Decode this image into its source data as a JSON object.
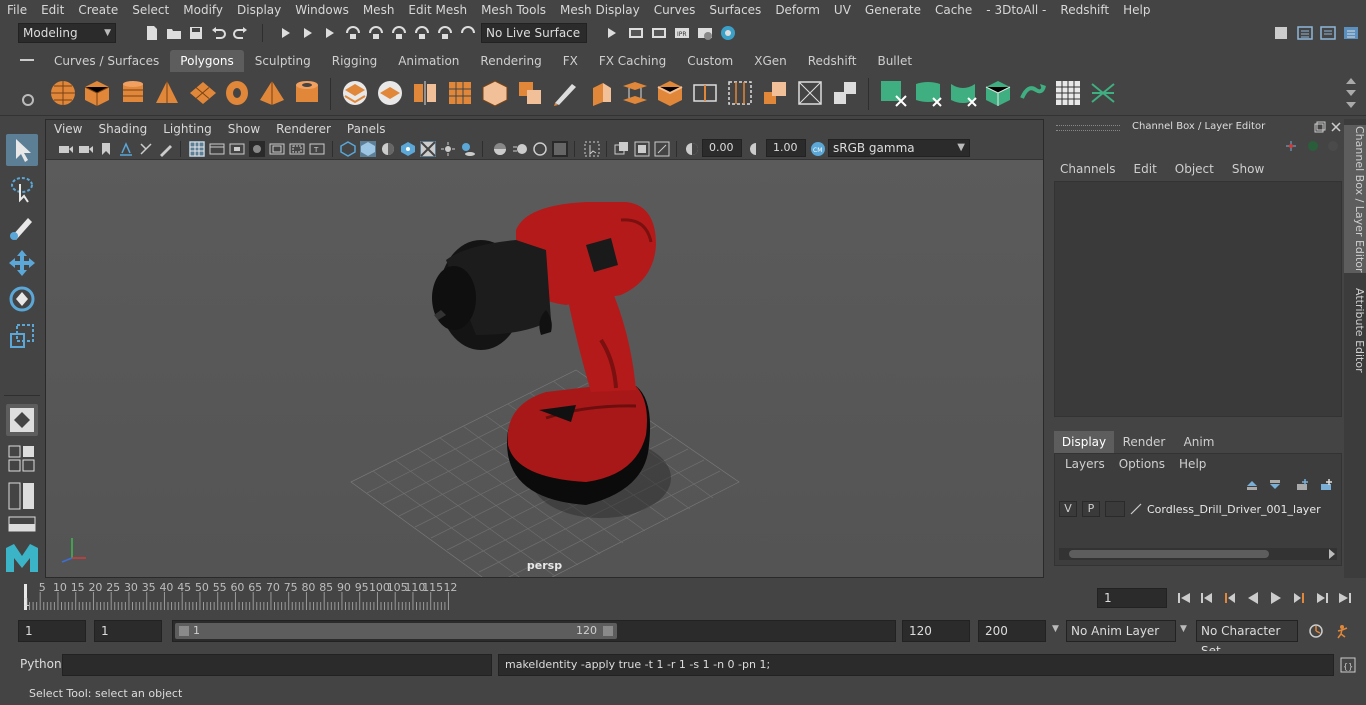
{
  "menubar": [
    "File",
    "Edit",
    "Create",
    "Select",
    "Modify",
    "Display",
    "Windows",
    "Mesh",
    "Edit Mesh",
    "Mesh Tools",
    "Mesh Display",
    "Curves",
    "Surfaces",
    "Deform",
    "UV",
    "Generate",
    "Cache",
    "- 3DtoAll -",
    "Redshift",
    "Help"
  ],
  "status": {
    "mode": "Modeling",
    "live_surface": "No Live Surface"
  },
  "shelf_tabs": [
    "Curves / Surfaces",
    "Polygons",
    "Sculpting",
    "Rigging",
    "Animation",
    "Rendering",
    "FX",
    "FX Caching",
    "Custom",
    "XGen",
    "Redshift",
    "Bullet"
  ],
  "shelf_active": "Polygons",
  "viewport": {
    "menu": [
      "View",
      "Shading",
      "Lighting",
      "Show",
      "Renderer",
      "Panels"
    ],
    "exposure": "0.00",
    "gamma": "1.00",
    "colorspace": "sRGB gamma",
    "camera": "persp"
  },
  "channel_box": {
    "title": "Channel Box / Layer Editor",
    "menu": [
      "Channels",
      "Edit",
      "Object",
      "Show"
    ]
  },
  "layer_editor": {
    "tabs": [
      "Display",
      "Render",
      "Anim"
    ],
    "active_tab": "Display",
    "menu": [
      "Layers",
      "Options",
      "Help"
    ],
    "layers": [
      {
        "v": "V",
        "p": "P",
        "name": "Cordless_Drill_Driver_001_layer"
      }
    ]
  },
  "side_tabs": [
    "Channel Box / Layer Editor",
    "Attribute Editor"
  ],
  "timeline": {
    "ticks": [
      "5",
      "10",
      "15",
      "20",
      "25",
      "30",
      "35",
      "40",
      "45",
      "50",
      "55",
      "60",
      "65",
      "70",
      "75",
      "80",
      "85",
      "90",
      "95",
      "100",
      "105",
      "110",
      "115",
      "12"
    ],
    "start_tick": "1",
    "current_frame": "1"
  },
  "range": {
    "start": "1",
    "playback_start": "1",
    "slider_start": "1",
    "slider_end": "120",
    "playback_end": "120",
    "end": "200",
    "anim_layer": "No Anim Layer",
    "char_set": "No Character Set"
  },
  "command": {
    "lang": "Python",
    "result": "makeIdentity -apply true -t 1 -r 1 -s 1 -n 0 -pn 1;"
  },
  "help_line": "Select Tool: select an object",
  "colors": {
    "accent": "#5285a6",
    "drill_red": "#b51a1a",
    "shelf_orange": "#e0873a",
    "shelf_green": "#3fae80"
  }
}
